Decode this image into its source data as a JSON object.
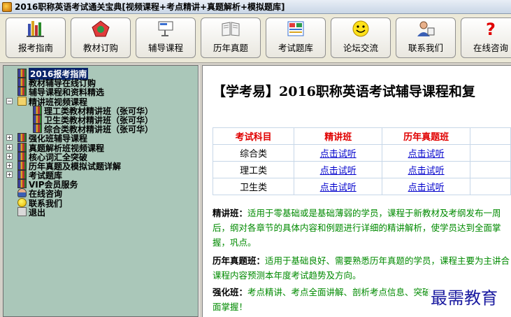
{
  "window": {
    "title": "2016职称英语考试通关宝典[视频课程+考点精讲+真题解析+模拟题库]"
  },
  "toolbar": {
    "buttons": [
      {
        "label": "报考指南",
        "icon": "books-icon"
      },
      {
        "label": "教材订购",
        "icon": "pentagon-icon"
      },
      {
        "label": "辅导课程",
        "icon": "projector-icon"
      },
      {
        "label": "历年真题",
        "icon": "open-book-icon"
      },
      {
        "label": "考试题库",
        "icon": "exam-paper-icon"
      },
      {
        "label": "论坛交流",
        "icon": "smiley-icon"
      },
      {
        "label": "联系我们",
        "icon": "contacts-icon"
      },
      {
        "label": "在线咨询",
        "icon": "question-icon"
      }
    ]
  },
  "tree": {
    "items": [
      {
        "label": "2016报考指南",
        "icon": "book-icon",
        "selected": true
      },
      {
        "label": "教材辅导在线订购",
        "icon": "book-icon"
      },
      {
        "label": "辅导课程和资料精选",
        "icon": "book-icon"
      },
      {
        "label": "精讲班视频课程",
        "icon": "folder-icon",
        "expander": "−"
      },
      {
        "label": "理工类教材精讲班（张可华）",
        "icon": "book-icon"
      },
      {
        "label": "卫生类教材精讲班（张可华）",
        "icon": "book-icon"
      },
      {
        "label": "综合类教材精讲班（张可华）",
        "icon": "book-icon"
      },
      {
        "label": "强化班辅导课程",
        "icon": "book-icon",
        "expander": "+"
      },
      {
        "label": "真题解析班视频课程",
        "icon": "book-icon",
        "expander": "+"
      },
      {
        "label": "核心词汇全突破",
        "icon": "book-icon",
        "expander": "+"
      },
      {
        "label": "历年真题及模拟试题详解",
        "icon": "book-icon",
        "expander": "+"
      },
      {
        "label": "考试题库",
        "icon": "book-icon",
        "expander": "+"
      },
      {
        "label": "VIP会员服务",
        "icon": "book-icon"
      },
      {
        "label": "在线咨询",
        "icon": "person-icon"
      },
      {
        "label": "联系我们",
        "icon": "smiley-icon"
      },
      {
        "label": "退出",
        "icon": "exit-icon"
      }
    ]
  },
  "content": {
    "title": "【学考易】2016职称英语考试辅导课程和复",
    "table": {
      "headers": [
        "考试科目",
        "精讲班",
        "历年真题班"
      ],
      "rows": [
        {
          "subject": "综合类",
          "col1": "点击试听",
          "col2": "点击试听"
        },
        {
          "subject": "理工类",
          "col1": "点击试听",
          "col2": "点击试听"
        },
        {
          "subject": "卫生类",
          "col1": "点击试听",
          "col2": "点击试听"
        }
      ]
    },
    "descriptions": [
      {
        "key": "精讲班：",
        "text": "适用于零基础或是基础薄弱的学员，课程于新教材及考纲发布一周后，纲对各章节的具体内容和例题进行详细的精讲解析，使学员达到全面掌握，巩点。"
      },
      {
        "key": "历年真题班：",
        "text": "适用于基础良好、需要熟悉历年真题的学员，课程主要为主讲合课程内容预测本年度考试趋势及方向。"
      },
      {
        "key": "强化班：",
        "text": "考点精讲、考点全面讲解、剖析考点信息、突破面掌握！"
      }
    ],
    "watermark": "最需教育"
  },
  "colors": {
    "tree_bg": "#aac7b9",
    "selection": "#0a246a",
    "header_red": "#e00000",
    "link_blue": "#0000cc",
    "desc_green": "#008a00"
  }
}
